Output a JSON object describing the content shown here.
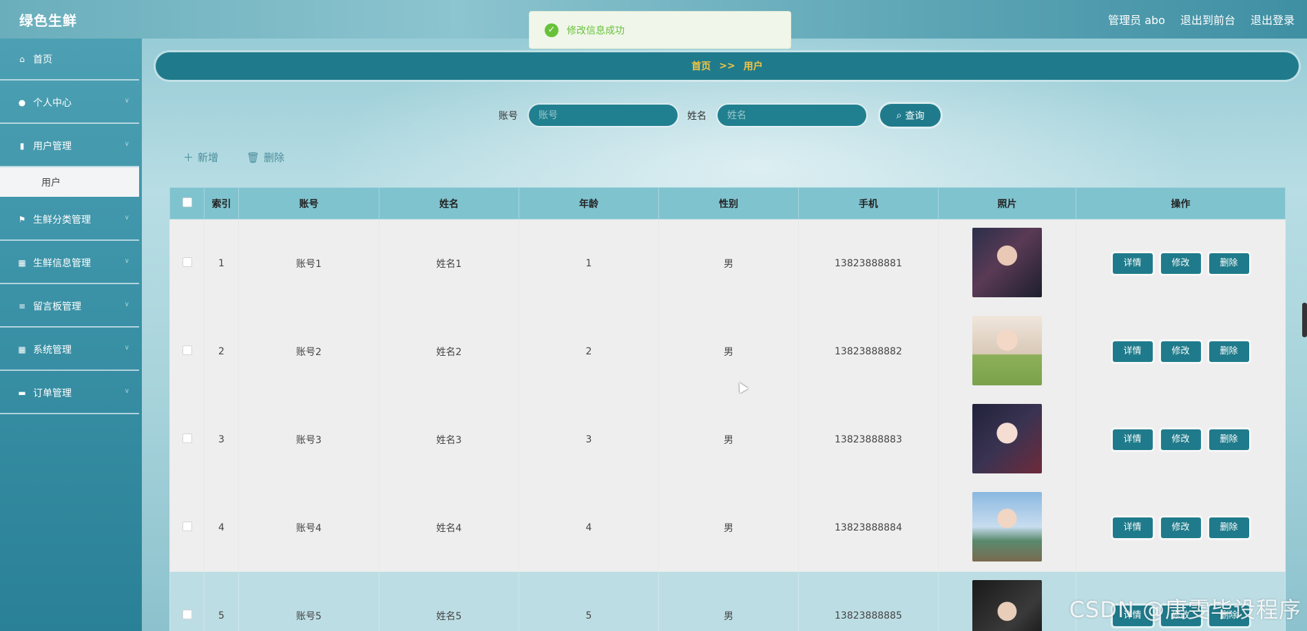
{
  "header": {
    "app_title": "绿色生鲜",
    "links": [
      "管理员 abo",
      "退出到前台",
      "退出登录"
    ]
  },
  "toast": {
    "message": "修改信息成功"
  },
  "sidebar": {
    "items": [
      {
        "label": "首页",
        "icon": "home-icon"
      },
      {
        "label": "个人中心",
        "icon": "user-icon"
      },
      {
        "label": "用户管理",
        "icon": "clipboard-icon"
      },
      {
        "label": "生鲜分类管理",
        "icon": "flag-icon"
      },
      {
        "label": "生鲜信息管理",
        "icon": "grid-icon"
      },
      {
        "label": "留言板管理",
        "icon": "list-icon"
      },
      {
        "label": "系统管理",
        "icon": "grid-icon"
      },
      {
        "label": "订单管理",
        "icon": "chat-icon"
      }
    ],
    "submenu_active": "用户"
  },
  "breadcrumb": {
    "home": "首页",
    "separator": ">>",
    "current": "用户"
  },
  "search": {
    "account_label": "账号",
    "account_placeholder": "账号",
    "name_label": "姓名",
    "name_placeholder": "姓名",
    "query_button": "查询"
  },
  "actions": {
    "add": "新增",
    "delete": "删除"
  },
  "table": {
    "columns": [
      "",
      "索引",
      "账号",
      "姓名",
      "年龄",
      "性别",
      "手机",
      "照片",
      "操作"
    ],
    "rows": [
      {
        "index": "1",
        "account": "账号1",
        "name": "姓名1",
        "age": "1",
        "gender": "男",
        "phone": "13823888881"
      },
      {
        "index": "2",
        "account": "账号2",
        "name": "姓名2",
        "age": "2",
        "gender": "男",
        "phone": "13823888882"
      },
      {
        "index": "3",
        "account": "账号3",
        "name": "姓名3",
        "age": "3",
        "gender": "男",
        "phone": "13823888883"
      },
      {
        "index": "4",
        "account": "账号4",
        "name": "姓名4",
        "age": "4",
        "gender": "男",
        "phone": "13823888884"
      },
      {
        "index": "5",
        "account": "账号5",
        "name": "姓名5",
        "age": "5",
        "gender": "男",
        "phone": "13823888885"
      }
    ],
    "row_buttons": {
      "detail": "详情",
      "edit": "修改",
      "delete": "删除"
    }
  },
  "watermark": "CSDN @唐雯毕设程序",
  "colors": {
    "accent": "#1f7b8b",
    "header_bg": "#7fc3cf",
    "breadcrumb_text": "#f5c542",
    "success": "#67c23a"
  }
}
